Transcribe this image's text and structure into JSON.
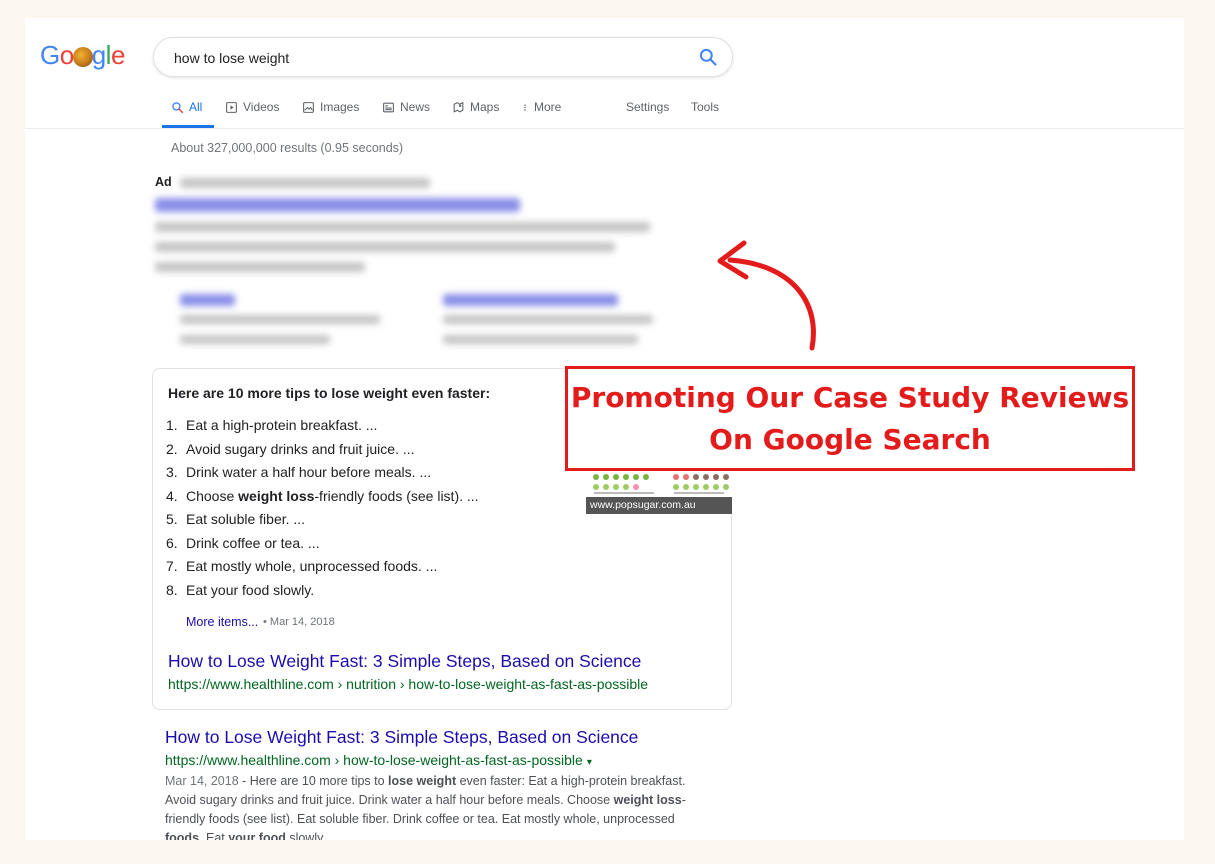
{
  "search": {
    "query": "how to lose weight"
  },
  "tabs": [
    {
      "label": "All",
      "icon": "search-icon"
    },
    {
      "label": "Videos",
      "icon": "video-icon"
    },
    {
      "label": "Images",
      "icon": "image-icon"
    },
    {
      "label": "News",
      "icon": "news-icon"
    },
    {
      "label": "Maps",
      "icon": "map-icon"
    },
    {
      "label": "More",
      "icon": "more-vert-icon"
    },
    {
      "label": "Settings"
    },
    {
      "label": "Tools"
    }
  ],
  "result_stats": "About 327,000,000 results (0.95 seconds)",
  "ad": {
    "label": "Ad"
  },
  "featured_snippet": {
    "heading": "Here are 10 more tips to lose weight even faster:",
    "items": [
      {
        "num": "1.",
        "text": "Eat a high-protein breakfast. ..."
      },
      {
        "num": "2.",
        "text": "Avoid sugary drinks and fruit juice. ..."
      },
      {
        "num": "3.",
        "text": "Drink water a half hour before meals. ..."
      },
      {
        "num": "4.",
        "pre": "Choose ",
        "bold": "weight loss",
        "post": "-friendly foods (see list). ..."
      },
      {
        "num": "5.",
        "text": "Eat soluble fiber. ..."
      },
      {
        "num": "6.",
        "text": "Drink coffee or tea. ..."
      },
      {
        "num": "7.",
        "text": "Eat mostly whole, unprocessed foods. ..."
      },
      {
        "num": "8.",
        "text": "Eat your food slowly."
      }
    ],
    "more_items": "More items...",
    "date": "• Mar 14, 2018",
    "image_caption": "www.popsugar.com.au",
    "title": "How to Lose Weight Fast: 3 Simple Steps, Based on Science",
    "url": "https://www.healthline.com › nutrition › how-to-lose-weight-as-fast-as-possible"
  },
  "organic_result": {
    "title": "How to Lose Weight Fast: 3 Simple Steps, Based on Science",
    "url": "https://www.healthline.com › how-to-lose-weight-as-fast-as-possible",
    "url_caret": "▾",
    "date": "Mar 14, 2018",
    "desc_1": " - Here are 10 more tips to ",
    "desc_bold_1": "lose weight",
    "desc_2": " even faster: Eat a high-protein breakfast. Avoid sugary drinks and fruit juice. Drink water a half hour before meals. Choose ",
    "desc_bold_2": "weight loss",
    "desc_3": "-friendly foods (see list). Eat soluble fiber. Drink coffee or tea. Eat mostly whole, unprocessed ",
    "desc_bold_3": "foods",
    "desc_4": ". Eat ",
    "desc_bold_4": "your food",
    "desc_5": " slowly."
  },
  "callout": {
    "line1": "Promoting Our Case Study Reviews",
    "line2": "On Google Search",
    "color": "#e31b1b"
  },
  "colors": {
    "link": "#1a0dab",
    "url": "#006621",
    "accent": "#1a73e8",
    "background": "#fcf8f1"
  }
}
